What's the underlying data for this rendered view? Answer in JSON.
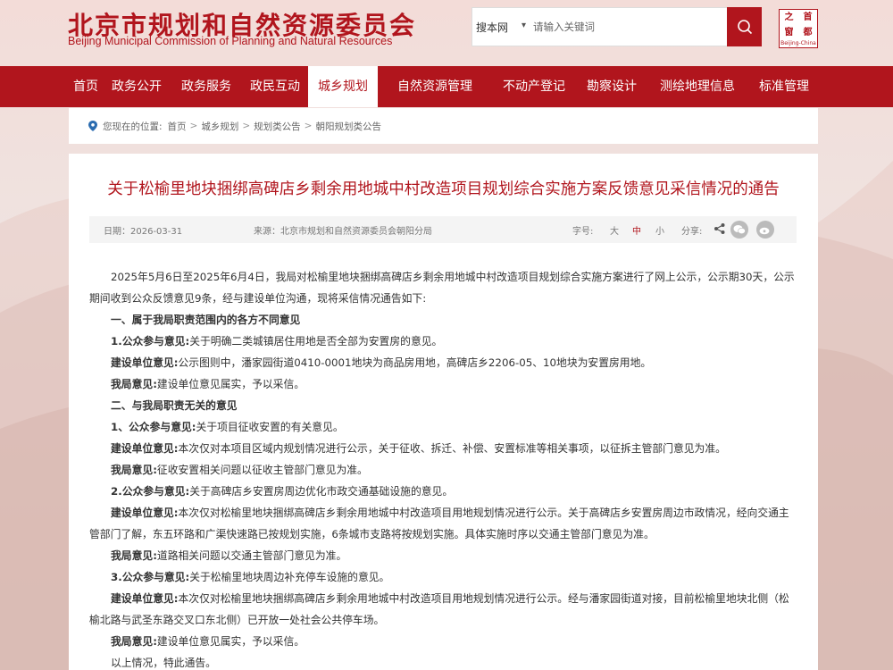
{
  "header": {
    "site_title": "北京市规划和自然资源委员会",
    "site_title_en": "Beijing Municipal Commission of Planning and Natural Resources",
    "search": {
      "scope": "搜本网",
      "placeholder": "请输入关键词"
    },
    "seal": {
      "chars": [
        "之",
        "首",
        "窗",
        "都"
      ],
      "subtitle": "Beijing-China"
    }
  },
  "nav": {
    "items": [
      {
        "label": "首页"
      },
      {
        "label": "政务公开"
      },
      {
        "label": "政务服务"
      },
      {
        "label": "政民互动"
      },
      {
        "label": "城乡规划"
      },
      {
        "label": "自然资源管理"
      },
      {
        "label": "不动产登记"
      },
      {
        "label": "勘察设计"
      },
      {
        "label": "测绘地理信息"
      },
      {
        "label": "标准管理"
      }
    ],
    "active": "城乡规划"
  },
  "breadcrumb": {
    "prefix": "您现在的位置:",
    "items": [
      "首页",
      "城乡规划",
      "规划类公告",
      "朝阳规划类公告"
    ]
  },
  "article": {
    "title": "关于松榆里地块捆绑高碑店乡剩余用地城中村改造项目规划综合实施方案反馈意见采信情况的通告",
    "meta": {
      "date": "日期：2026-03-31",
      "source": "来源：北京市规划和自然资源委员会朝阳分局",
      "font_size_label": "字号:",
      "font_sizes": [
        "大",
        "中",
        "小"
      ],
      "share_label": "分享:"
    },
    "paragraphs": {
      "p1": "2025年5月6日至2025年6月4日，我局对松榆里地块捆绑高碑店乡剩余用地城中村改造项目规划综合实施方案进行了网上公示，公示期30天，公示期间收到公众反馈意见9条，经与建设单位沟通，现将采信情况通告如下:",
      "s1": "一、属于我局职责范围内的各方不同意见",
      "s1_pub_label": "1.公众参与意见:",
      "s1_pub": "关于明确二类城镇居住用地是否全部为安置房的意见。",
      "s1_con_label": "建设单位意见:",
      "s1_con": "公示图则中，潘家园街道0410-0001地块为商品房用地，高碑店乡2206-05、10地块为安置房用地。",
      "s1_our_label": "我局意见:",
      "s1_our": "建设单位意见属实，予以采信。",
      "s2": "二、与我局职责无关的意见",
      "s2a_pub_label": "1、公众参与意见:",
      "s2a_pub": "关于项目征收安置的有关意见。",
      "s2a_con_label": "建设单位意见:",
      "s2a_con": "本次仅对本项目区域内规划情况进行公示，关于征收、拆迁、补偿、安置标准等相关事项，以征拆主管部门意见为准。",
      "s2a_our_label": "我局意见:",
      "s2a_our": "征收安置相关问题以征收主管部门意见为准。",
      "s2b_pub_label": "2.公众参与意见:",
      "s2b_pub": "关于高碑店乡安置房周边优化市政交通基础设施的意见。",
      "s2b_con_label": "建设单位意见:",
      "s2b_con": "本次仅对松榆里地块捆绑高碑店乡剩余用地城中村改造项目用地规划情况进行公示。关于高碑店乡安置房周边市政情况，经向交通主管部门了解，东五环路和广渠快速路已按规划实施，6条城市支路将按规划实施。具体实施时序以交通主管部门意见为准。",
      "s2b_our_label": "我局意见:",
      "s2b_our": "道路相关问题以交通主管部门意见为准。",
      "s2c_pub_label": "3.公众参与意见:",
      "s2c_pub": "关于松榆里地块周边补充停车设施的意见。",
      "s2c_con_label": "建设单位意见:",
      "s2c_con": "本次仅对松榆里地块捆绑高碑店乡剩余用地城中村改造项目用地规划情况进行公示。经与潘家园街道对接，目前松榆里地块北侧（松榆北路与武圣东路交叉口东北侧）已开放一处社会公共停车场。",
      "s2c_our_label": "我局意见:",
      "s2c_our": "建设单位意见属实，予以采信。",
      "end": "以上情况，特此通告。"
    }
  },
  "colors": {
    "brand_red": "#b1151d",
    "meta_bg": "#f4f4f4"
  }
}
